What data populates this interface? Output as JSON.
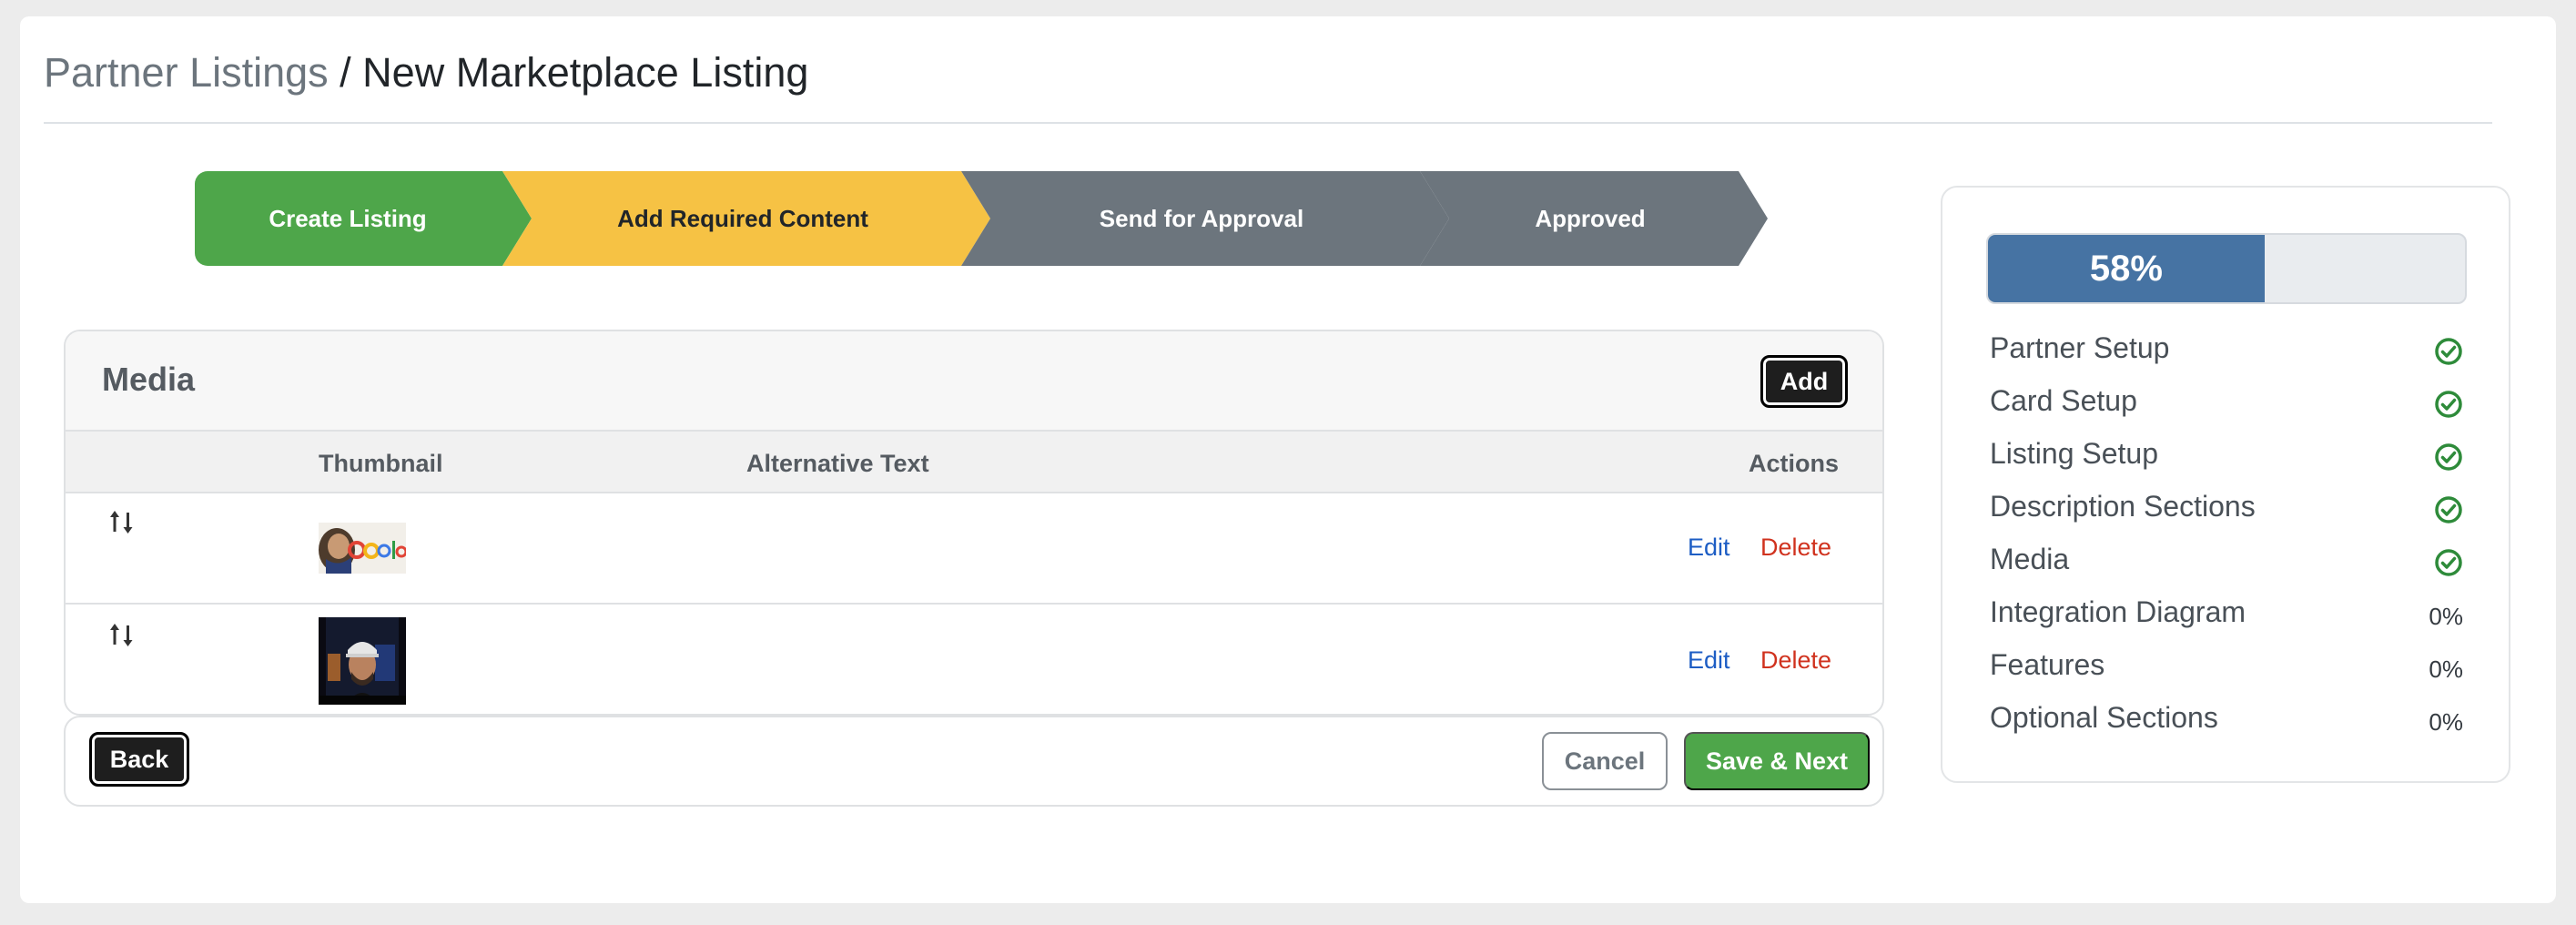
{
  "breadcrumb": {
    "parent": "Partner Listings",
    "separator": " / ",
    "current": "New Marketplace Listing"
  },
  "stepper": {
    "steps": [
      {
        "label": "Create Listing",
        "state": "complete",
        "color": "#4ea64a"
      },
      {
        "label": "Add Required Content",
        "state": "current",
        "color": "#f6c244"
      },
      {
        "label": "Send for Approval",
        "state": "pending",
        "color": "#6c757d"
      },
      {
        "label": "Approved",
        "state": "pending",
        "color": "#6c757d"
      }
    ]
  },
  "media": {
    "title": "Media",
    "add_label": "Add",
    "columns": {
      "thumbnail": "Thumbnail",
      "alt_text": "Alternative Text",
      "actions": "Actions"
    },
    "rows": [
      {
        "thumbnail": "google-logo-image",
        "alt_text": "",
        "edit_label": "Edit",
        "delete_label": "Delete"
      },
      {
        "thumbnail": "person-video-image",
        "alt_text": "",
        "edit_label": "Edit",
        "delete_label": "Delete"
      }
    ]
  },
  "footer": {
    "back_label": "Back",
    "cancel_label": "Cancel",
    "save_label": "Save & Next"
  },
  "progress": {
    "percent": 58,
    "percent_label": "58%",
    "fill_color": "#4673a3",
    "items": [
      {
        "label": "Partner Setup",
        "status": "complete",
        "icon": "check-circle-icon"
      },
      {
        "label": "Card Setup",
        "status": "complete",
        "icon": "check-circle-icon"
      },
      {
        "label": "Listing Setup",
        "status": "complete",
        "icon": "check-circle-icon"
      },
      {
        "label": "Description Sections",
        "status": "complete",
        "icon": "check-circle-icon"
      },
      {
        "label": "Media",
        "status": "complete",
        "icon": "check-circle-icon"
      },
      {
        "label": "Integration Diagram",
        "status": "0%"
      },
      {
        "label": "Features",
        "status": "0%"
      },
      {
        "label": "Optional Sections",
        "status": "0%"
      }
    ]
  }
}
